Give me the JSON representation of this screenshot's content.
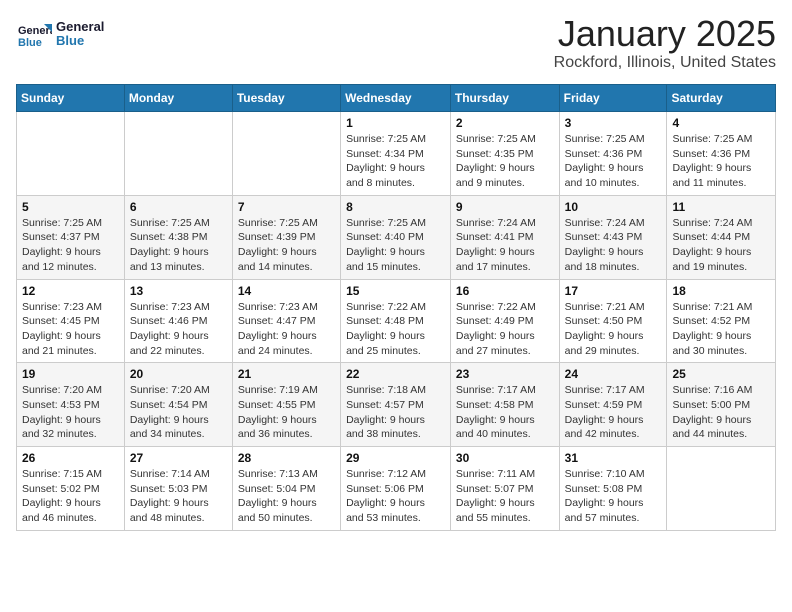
{
  "logo": {
    "line1": "General",
    "line2": "Blue"
  },
  "title": "January 2025",
  "subtitle": "Rockford, Illinois, United States",
  "weekdays": [
    "Sunday",
    "Monday",
    "Tuesday",
    "Wednesday",
    "Thursday",
    "Friday",
    "Saturday"
  ],
  "weeks": [
    [
      {
        "day": "",
        "info": ""
      },
      {
        "day": "",
        "info": ""
      },
      {
        "day": "",
        "info": ""
      },
      {
        "day": "1",
        "info": "Sunrise: 7:25 AM\nSunset: 4:34 PM\nDaylight: 9 hours and 8 minutes."
      },
      {
        "day": "2",
        "info": "Sunrise: 7:25 AM\nSunset: 4:35 PM\nDaylight: 9 hours and 9 minutes."
      },
      {
        "day": "3",
        "info": "Sunrise: 7:25 AM\nSunset: 4:36 PM\nDaylight: 9 hours and 10 minutes."
      },
      {
        "day": "4",
        "info": "Sunrise: 7:25 AM\nSunset: 4:36 PM\nDaylight: 9 hours and 11 minutes."
      }
    ],
    [
      {
        "day": "5",
        "info": "Sunrise: 7:25 AM\nSunset: 4:37 PM\nDaylight: 9 hours and 12 minutes."
      },
      {
        "day": "6",
        "info": "Sunrise: 7:25 AM\nSunset: 4:38 PM\nDaylight: 9 hours and 13 minutes."
      },
      {
        "day": "7",
        "info": "Sunrise: 7:25 AM\nSunset: 4:39 PM\nDaylight: 9 hours and 14 minutes."
      },
      {
        "day": "8",
        "info": "Sunrise: 7:25 AM\nSunset: 4:40 PM\nDaylight: 9 hours and 15 minutes."
      },
      {
        "day": "9",
        "info": "Sunrise: 7:24 AM\nSunset: 4:41 PM\nDaylight: 9 hours and 17 minutes."
      },
      {
        "day": "10",
        "info": "Sunrise: 7:24 AM\nSunset: 4:43 PM\nDaylight: 9 hours and 18 minutes."
      },
      {
        "day": "11",
        "info": "Sunrise: 7:24 AM\nSunset: 4:44 PM\nDaylight: 9 hours and 19 minutes."
      }
    ],
    [
      {
        "day": "12",
        "info": "Sunrise: 7:23 AM\nSunset: 4:45 PM\nDaylight: 9 hours and 21 minutes."
      },
      {
        "day": "13",
        "info": "Sunrise: 7:23 AM\nSunset: 4:46 PM\nDaylight: 9 hours and 22 minutes."
      },
      {
        "day": "14",
        "info": "Sunrise: 7:23 AM\nSunset: 4:47 PM\nDaylight: 9 hours and 24 minutes."
      },
      {
        "day": "15",
        "info": "Sunrise: 7:22 AM\nSunset: 4:48 PM\nDaylight: 9 hours and 25 minutes."
      },
      {
        "day": "16",
        "info": "Sunrise: 7:22 AM\nSunset: 4:49 PM\nDaylight: 9 hours and 27 minutes."
      },
      {
        "day": "17",
        "info": "Sunrise: 7:21 AM\nSunset: 4:50 PM\nDaylight: 9 hours and 29 minutes."
      },
      {
        "day": "18",
        "info": "Sunrise: 7:21 AM\nSunset: 4:52 PM\nDaylight: 9 hours and 30 minutes."
      }
    ],
    [
      {
        "day": "19",
        "info": "Sunrise: 7:20 AM\nSunset: 4:53 PM\nDaylight: 9 hours and 32 minutes."
      },
      {
        "day": "20",
        "info": "Sunrise: 7:20 AM\nSunset: 4:54 PM\nDaylight: 9 hours and 34 minutes."
      },
      {
        "day": "21",
        "info": "Sunrise: 7:19 AM\nSunset: 4:55 PM\nDaylight: 9 hours and 36 minutes."
      },
      {
        "day": "22",
        "info": "Sunrise: 7:18 AM\nSunset: 4:57 PM\nDaylight: 9 hours and 38 minutes."
      },
      {
        "day": "23",
        "info": "Sunrise: 7:17 AM\nSunset: 4:58 PM\nDaylight: 9 hours and 40 minutes."
      },
      {
        "day": "24",
        "info": "Sunrise: 7:17 AM\nSunset: 4:59 PM\nDaylight: 9 hours and 42 minutes."
      },
      {
        "day": "25",
        "info": "Sunrise: 7:16 AM\nSunset: 5:00 PM\nDaylight: 9 hours and 44 minutes."
      }
    ],
    [
      {
        "day": "26",
        "info": "Sunrise: 7:15 AM\nSunset: 5:02 PM\nDaylight: 9 hours and 46 minutes."
      },
      {
        "day": "27",
        "info": "Sunrise: 7:14 AM\nSunset: 5:03 PM\nDaylight: 9 hours and 48 minutes."
      },
      {
        "day": "28",
        "info": "Sunrise: 7:13 AM\nSunset: 5:04 PM\nDaylight: 9 hours and 50 minutes."
      },
      {
        "day": "29",
        "info": "Sunrise: 7:12 AM\nSunset: 5:06 PM\nDaylight: 9 hours and 53 minutes."
      },
      {
        "day": "30",
        "info": "Sunrise: 7:11 AM\nSunset: 5:07 PM\nDaylight: 9 hours and 55 minutes."
      },
      {
        "day": "31",
        "info": "Sunrise: 7:10 AM\nSunset: 5:08 PM\nDaylight: 9 hours and 57 minutes."
      },
      {
        "day": "",
        "info": ""
      }
    ]
  ]
}
